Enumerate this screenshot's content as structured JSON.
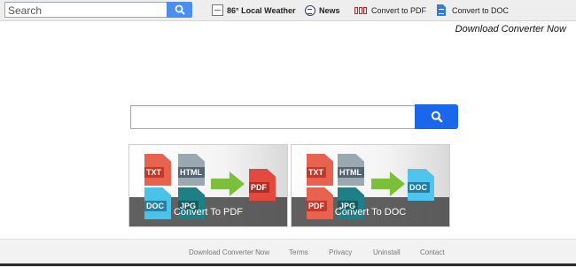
{
  "topbar": {
    "search_placeholder": "Search",
    "weather_label": "86° Local Weather",
    "news_label": "News",
    "pdf_label": "Convert to PDF",
    "doc_label": "Convert to DOC"
  },
  "download_link": "Download Converter Now",
  "main_search": {
    "placeholder": ""
  },
  "cards": [
    {
      "label": "Convert To PDF",
      "files": [
        "TXT",
        "HTML",
        "DOC",
        "JPG"
      ],
      "output": "PDF"
    },
    {
      "label": "Convert To DOC",
      "files": [
        "TXT",
        "HTML",
        "PDF",
        "JPG"
      ],
      "output": "DOC"
    }
  ],
  "footer": {
    "links": [
      "Download Converter Now",
      "Terms",
      "Privacy",
      "Uninstall",
      "Contact"
    ]
  },
  "colors": {
    "accent_blue": "#1a67ec",
    "top_search_blue": "#4a8ef0",
    "arrow_green": "#7bbf3a"
  },
  "icons": [
    "search-icon",
    "weather-icon",
    "news-icon",
    "pdf-icon",
    "doc-icon"
  ]
}
